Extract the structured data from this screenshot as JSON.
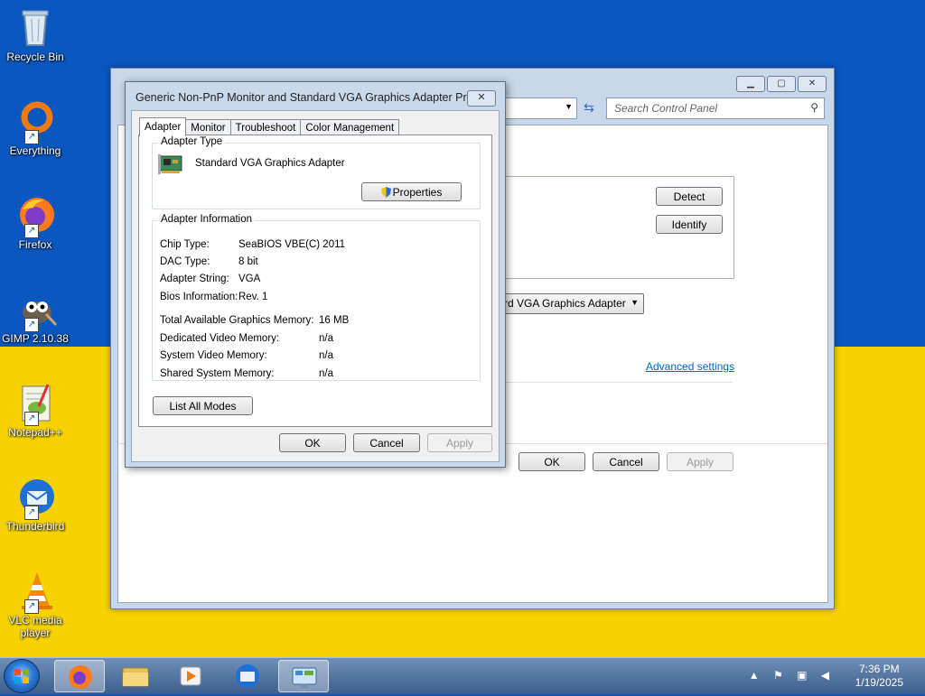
{
  "desktop": {
    "icons": [
      {
        "label": "Recycle Bin"
      },
      {
        "label": "Everything"
      },
      {
        "label": "Firefox"
      },
      {
        "label": "GIMP 2.10.38"
      },
      {
        "label": "Notepad++"
      },
      {
        "label": "Thunderbird"
      },
      {
        "label": "VLC media player"
      }
    ]
  },
  "control_panel": {
    "search_placeholder": "Search Control Panel",
    "detect_label": "Detect",
    "identify_label": "Identify",
    "display_dropdown": "rd VGA Graphics Adapter",
    "advanced_link": "Advanced settings",
    "ok_label": "OK",
    "cancel_label": "Cancel",
    "apply_label": "Apply"
  },
  "dialog": {
    "title": "Generic Non-PnP Monitor and Standard VGA Graphics Adapter Pro...",
    "close_glyph": "✕",
    "tabs": [
      "Adapter",
      "Monitor",
      "Troubleshoot",
      "Color Management"
    ],
    "adapter_type": {
      "legend": "Adapter Type",
      "name": "Standard VGA Graphics Adapter",
      "properties_label": "Properties"
    },
    "adapter_info": {
      "legend": "Adapter Information",
      "rows": [
        {
          "label": "Chip Type:",
          "value": "SeaBIOS VBE(C) 2011"
        },
        {
          "label": "DAC Type:",
          "value": "8 bit"
        },
        {
          "label": "Adapter String:",
          "value": "VGA"
        },
        {
          "label": "Bios Information:",
          "value": "Rev. 1"
        }
      ],
      "memory": [
        {
          "label": "Total Available Graphics Memory:",
          "value": "16 MB"
        },
        {
          "label": "Dedicated Video Memory:",
          "value": "n/a"
        },
        {
          "label": "System Video Memory:",
          "value": "n/a"
        },
        {
          "label": "Shared System Memory:",
          "value": "n/a"
        }
      ]
    },
    "list_all_modes_label": "List All Modes",
    "ok_label": "OK",
    "cancel_label": "Cancel",
    "apply_label": "Apply"
  },
  "taskbar": {
    "time": "7:36 PM",
    "date": "1/19/2025",
    "tray_up": "▲"
  }
}
